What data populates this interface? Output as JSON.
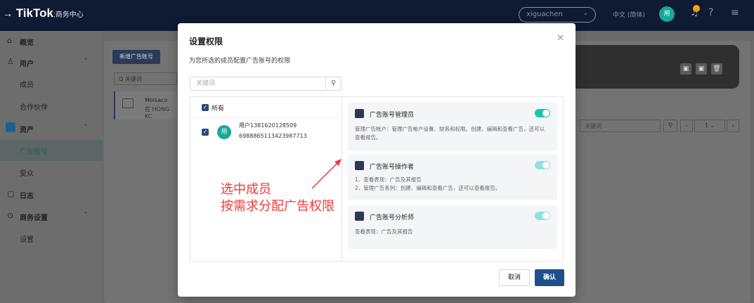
{
  "topbar": {
    "brand": "TikTok",
    "brand_sub": ":商务中心",
    "account": "xiguachen",
    "language": "中文 (简体)",
    "avatar": "用",
    "icons": [
      "bell-icon",
      "help-icon",
      "menu-icon"
    ]
  },
  "sidebar": {
    "items": [
      {
        "label": "概览",
        "icon": "home-icon"
      },
      {
        "label": "用户",
        "icon": "user-icon"
      },
      {
        "label": "成员"
      },
      {
        "label": "合作伙伴"
      },
      {
        "label": "资产",
        "icon": "asset-icon"
      },
      {
        "label": "广告账号"
      },
      {
        "label": "受众"
      },
      {
        "label": "日志",
        "icon": "log-icon"
      },
      {
        "label": "商务设置",
        "icon": "settings-icon"
      },
      {
        "label": "设置"
      }
    ]
  },
  "background": {
    "new_button": "新增广告账号",
    "search_placeholder": "Q 关键词",
    "org_name": "Molsaco",
    "org_location": "在 HONG KC",
    "right_search_placeholder": "关键词",
    "page": "1"
  },
  "modal": {
    "title": "设置权限",
    "description": "为您所选的成员配置广告账号的权限",
    "search_placeholder": "关键词",
    "all_label": "所有",
    "user": {
      "avatar": "用",
      "name": "用户1381620128509",
      "id": "6988865113423987713"
    },
    "roles": [
      {
        "title": "广告账号管理员",
        "description": "管理广告帐户：管理广告帐户设置、财务和权限。创建、编辑和查看广告，还可以查看报告。",
        "enabled": true
      },
      {
        "title": "广告账号操作者",
        "description_1": "1、查看表现：广告及其报告",
        "description_2": "2、管理广告系列：创建、编辑和查看广告，还可以查看报告。",
        "enabled": true
      },
      {
        "title": "广告账号分析师",
        "description": "查看表现：广告及其报告",
        "enabled": true
      }
    ],
    "cancel_label": "取消",
    "confirm_label": "确认"
  },
  "annotation": {
    "line1": "选中成员",
    "line2": "按需求分配广告权限"
  },
  "colors": {
    "topbar": "#0f1a33",
    "accent_teal": "#17c5b3",
    "primary_button": "#1f4e8c",
    "annotation_red": "#f03a3a"
  }
}
